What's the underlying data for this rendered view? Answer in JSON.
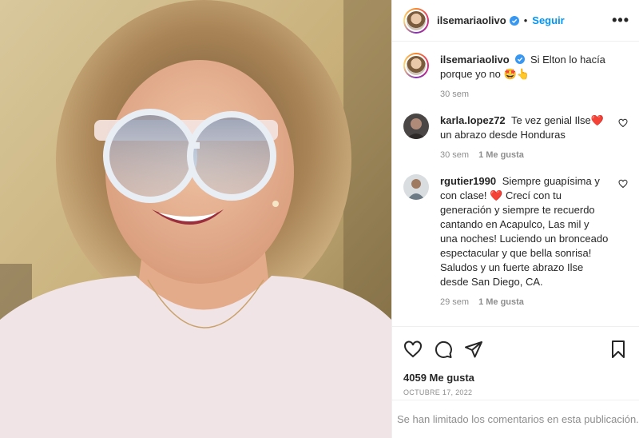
{
  "post": {
    "username": "ilsemariaolivo",
    "follow_label": "Seguir",
    "more_label": "•••",
    "separator": "•"
  },
  "caption": {
    "username": "ilsemariaolivo",
    "text": "Si Elton lo hacía porque yo no 🤩👆",
    "time": "30 sem"
  },
  "comments": [
    {
      "username": "karla.lopez72",
      "text": "Te vez genial Ilse❤️ un abrazo desde Honduras",
      "time": "30 sem",
      "likes": "1 Me gusta"
    },
    {
      "username": "rgutier1990",
      "text": "Siempre guapísima y con clase! ❤️ Crecí con tu generación y siempre te recuerdo cantando en Acapulco, Las mil y una noches! Luciendo un bronceado espectacular y que bella sonrisa! Saludos y un fuerte abrazo Ilse desde San Diego, CA.",
      "time": "29 sem",
      "likes": "1 Me gusta"
    }
  ],
  "stats": {
    "likes": "4059 Me gusta",
    "date": "OCTUBRE 17, 2022"
  },
  "footer": {
    "text": "Se han limitado los comentarios en esta publicación."
  },
  "colors": {
    "link": "#0095f6",
    "verified": "#3897f0",
    "muted": "#8e8e8e",
    "text": "#262626"
  },
  "icons": [
    "verified-icon",
    "more-icon",
    "heart-icon",
    "comment-icon",
    "share-icon",
    "save-icon",
    "small-heart-icon"
  ]
}
